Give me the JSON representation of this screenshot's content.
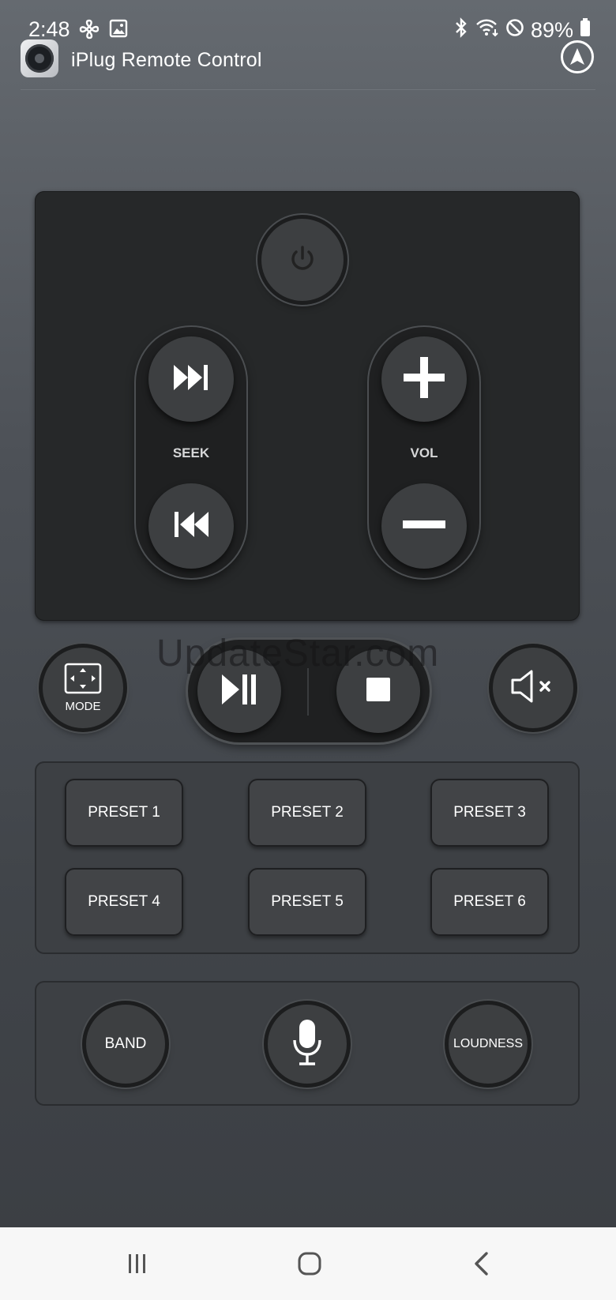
{
  "status": {
    "time": "2:48",
    "battery": "89%",
    "left_icons": [
      "fan-icon",
      "image-icon"
    ],
    "right_icons": [
      "bluetooth-icon",
      "wifi-icon",
      "dnd-icon",
      "battery-icon"
    ]
  },
  "app": {
    "title": "iPlug Remote Control",
    "nav_icon": "navigation-arrow-icon"
  },
  "remote": {
    "power_icon": "power-icon",
    "seek_label": "SEEK",
    "vol_label": "VOL",
    "mode_label": "MODE",
    "watermark": "UpdateStar.com"
  },
  "presets": [
    "PRESET 1",
    "PRESET 2",
    "PRESET 3",
    "PRESET 4",
    "PRESET 5",
    "PRESET 6"
  ],
  "bottom": {
    "band_label": "BAND",
    "loudness_label": "LOUDNESS"
  },
  "navbar": {
    "buttons": [
      "recents-button",
      "home-button",
      "back-button"
    ]
  }
}
